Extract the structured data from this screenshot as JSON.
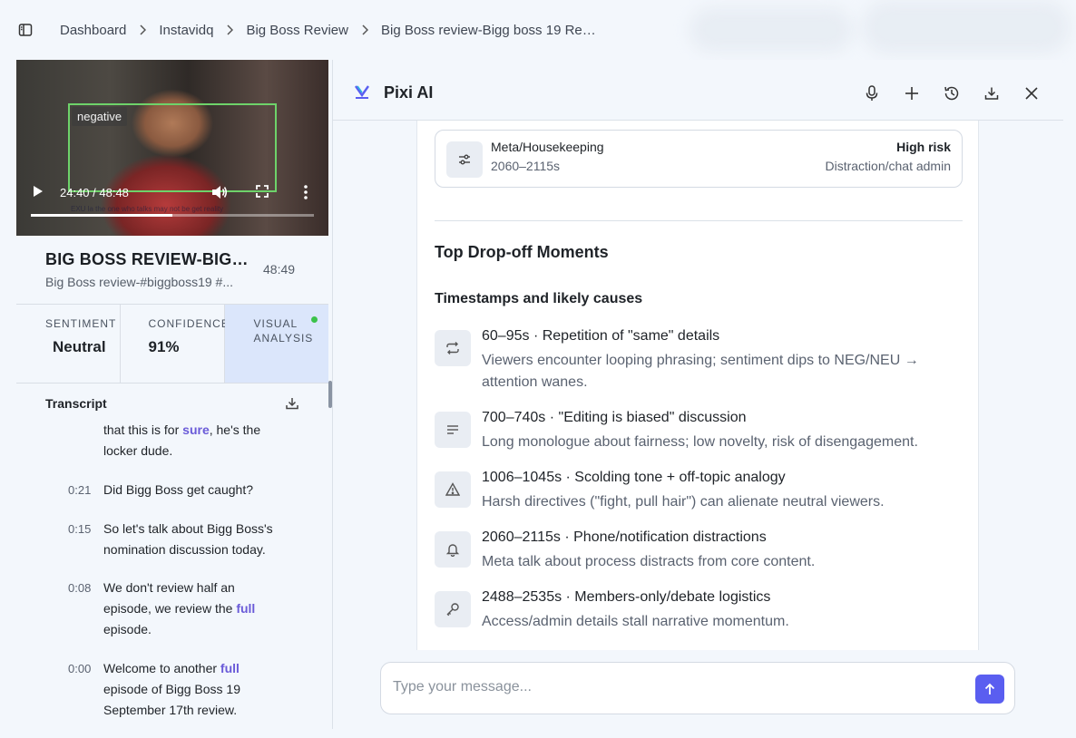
{
  "breadcrumb": {
    "items": [
      "Dashboard",
      "Instavidq",
      "Big Boss Review",
      "Big Boss review-Bigg boss 19 Revi..."
    ]
  },
  "video": {
    "overlay_tag": "negative",
    "time": "24:40 / 48:48",
    "progress": 0.5,
    "caption_ghost": "EXU la the one who talks may not be get reality"
  },
  "video_info": {
    "title": "BIG BOSS REVIEW-BIGG...",
    "subtitle": "Big Boss review-#biggboss19 #...",
    "duration": "48:49"
  },
  "stats": [
    {
      "label": "SENTIMENT",
      "value": "Neutral"
    },
    {
      "label": "CONFIDENCE",
      "value": "91%"
    },
    {
      "label": "VISUAL ANALYSIS",
      "value": ""
    }
  ],
  "transcript": {
    "heading": "Transcript",
    "rows": [
      {
        "time": "",
        "pre": "that this is for ",
        "hl": "sure",
        "post": ", he's the locker dude."
      },
      {
        "time": "0:21",
        "pre": "Did Bigg Boss get caught?",
        "hl": "",
        "post": ""
      },
      {
        "time": "0:15",
        "pre": "So let's talk about Bigg Boss's nomination discussion today.",
        "hl": "",
        "post": ""
      },
      {
        "time": "0:08",
        "pre": "We don't review half an episode, we review the ",
        "hl": "full",
        "post": " episode."
      },
      {
        "time": "0:00",
        "pre": "Welcome to another ",
        "hl": "full",
        "post": " episode of Bigg Boss 19 September 17th review."
      }
    ]
  },
  "chat": {
    "title": "Pixi AI",
    "risk_card": {
      "name": "Meta/Housekeeping",
      "range": "2060–2115s",
      "level": "High risk",
      "desc": "Distraction/chat admin"
    },
    "section_title": "Top Drop-off Moments",
    "section_subtitle": "Timestamps and likely causes",
    "moments": [
      {
        "icon": "repeat-icon",
        "title": "60–95s · Repetition of \"same\" details",
        "desc": "Viewers encounter looping phrasing; sentiment dips to NEG/NEU → attention wanes."
      },
      {
        "icon": "text-lines-icon",
        "title": "700–740s · \"Editing is biased\" discussion",
        "desc": "Long monologue about fairness; low novelty, risk of disengagement."
      },
      {
        "icon": "warning-icon",
        "title": "1006–1045s · Scolding tone + off-topic analogy",
        "desc": "Harsh directives (\"fight, pull hair\") can alienate neutral viewers."
      },
      {
        "icon": "bell-icon",
        "title": "2060–2115s · Phone/notification distractions",
        "desc": "Meta talk about process distracts from core content."
      },
      {
        "icon": "key-icon",
        "title": "2488–2535s · Members-only/debate logistics",
        "desc": "Access/admin details stall narrative momentum."
      }
    ],
    "composer_placeholder": "Type your message..."
  },
  "colors": {
    "accent": "#5a5ef0",
    "highlight": "#6a5bd8",
    "detection_box": "#6ed36a",
    "live_dot": "#3bc24a"
  }
}
